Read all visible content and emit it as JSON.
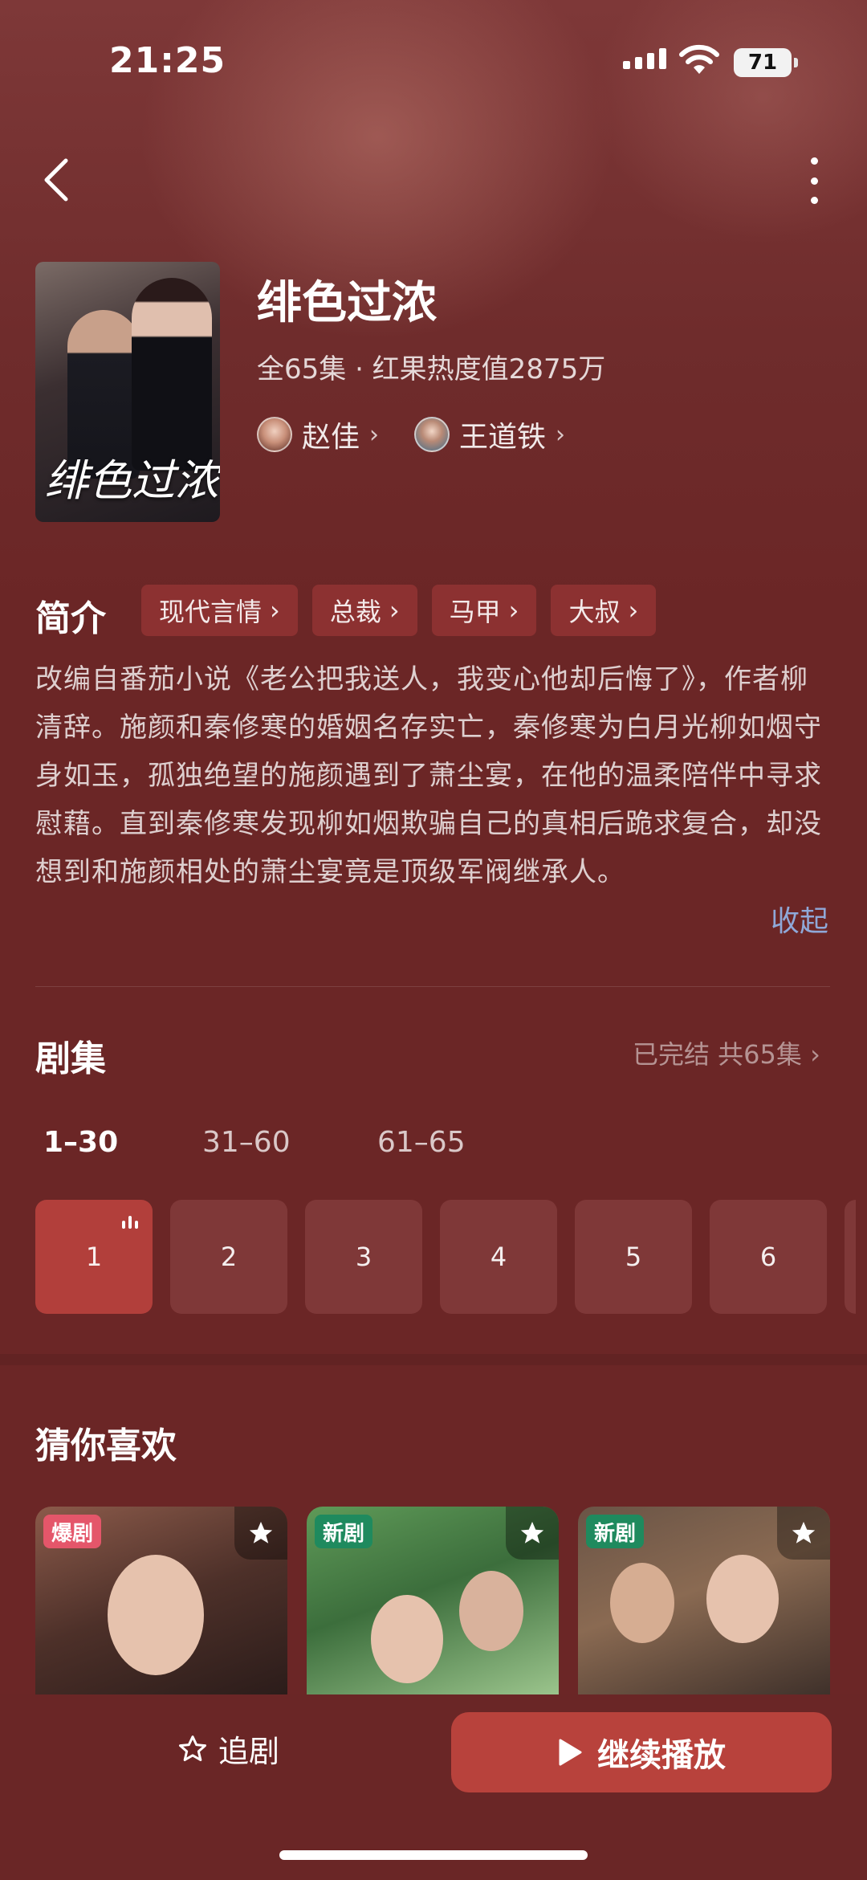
{
  "status_bar": {
    "time": "21:25",
    "battery": "71"
  },
  "header": {
    "back_icon": "chevron-left-icon",
    "more_icon": "vertical-dots-icon"
  },
  "drama": {
    "poster_title": "绯色过浓",
    "title": "绯色过浓",
    "meta": "全65集 · 红果热度值2875万",
    "cast": [
      {
        "name": "赵佳"
      },
      {
        "name": "王道铁"
      }
    ]
  },
  "intro": {
    "title": "简介",
    "tags": [
      "现代言情",
      "总裁",
      "马甲",
      "大叔"
    ],
    "text": "改编自番茄小说《老公把我送人，我变心他却后悔了》，作者柳清辞。施颜和秦修寒的婚姻名存实亡，秦修寒为白月光柳如烟守身如玉，孤独绝望的施颜遇到了萧尘宴，在他的温柔陪伴中寻求慰藉。直到秦修寒发现柳如烟欺骗自己的真相后跪求复合，却没想到和施颜相处的萧尘宴竟是顶级军阀继承人。",
    "collapse": "收起"
  },
  "episodes": {
    "title": "剧集",
    "status": "已完结 共65集",
    "ranges": [
      "1–30",
      "31–60",
      "61–65"
    ],
    "items": [
      "1",
      "2",
      "3",
      "4",
      "5",
      "6"
    ],
    "active_index": 0
  },
  "recommend": {
    "title": "猜你喜欢",
    "items": [
      {
        "badge": "爆剧"
      },
      {
        "badge": "新剧"
      },
      {
        "badge": "新剧"
      }
    ]
  },
  "bottom": {
    "follow": "追剧",
    "continue": "继续播放"
  },
  "colors": {
    "background": "#6b2626",
    "accent": "#b8423c",
    "tag": "#8c3131",
    "link": "#8fa8d8"
  }
}
